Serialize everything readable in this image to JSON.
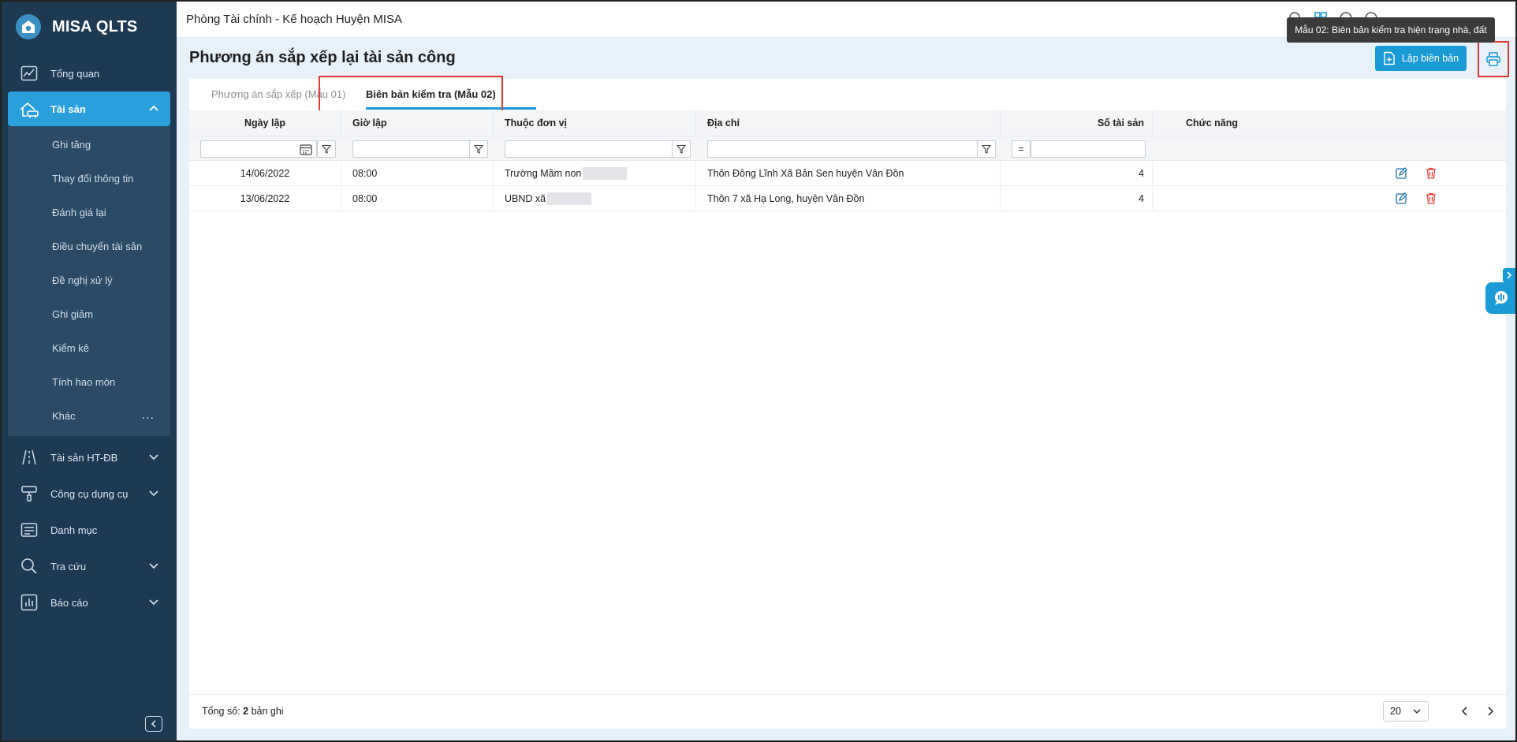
{
  "app": {
    "title": "MISA QLTS"
  },
  "topbar": {
    "org_title": "Phòng Tài chính - Kế hoạch Huyện MISA",
    "tooltip": "Mẫu 02: Biên bản kiểm tra hiện trạng nhà, đất"
  },
  "sidebar": {
    "items": [
      {
        "label": "Tổng quan",
        "icon": "chart-line-icon"
      },
      {
        "label": "Tài sản",
        "icon": "house-car-icon",
        "active": true,
        "expanded": true
      },
      {
        "label": "Tài sản HT-ĐB",
        "icon": "road-icon"
      },
      {
        "label": "Công cụ dụng cụ",
        "icon": "brush-icon"
      },
      {
        "label": "Danh mục",
        "icon": "list-card-icon"
      },
      {
        "label": "Tra cứu",
        "icon": "search-icon"
      },
      {
        "label": "Báo cáo",
        "icon": "report-chart-icon"
      }
    ],
    "submenu": [
      "Ghi tăng",
      "Thay đổi thông tin",
      "Đánh giá lại",
      "Điều chuyển tài sản",
      "Đề nghị xử lý",
      "Ghi giảm",
      "Kiểm kê",
      "Tính hao mòn",
      "Khác"
    ],
    "more_label": "..."
  },
  "page": {
    "title": "Phương án sắp xếp lại tài sản công",
    "create_button": "Lập biên bản",
    "tabs": [
      "Phương án sắp xếp (Mẫu 01)",
      "Biên bản kiểm tra (Mẫu 02)"
    ]
  },
  "table": {
    "columns": [
      "Ngày lập",
      "Giờ lập",
      "Thuộc đơn vị",
      "Địa chỉ",
      "Số tài sản",
      "Chức năng"
    ],
    "filter_operator": "=",
    "rows": [
      {
        "date": "14/06/2022",
        "time": "08:00",
        "unit": "Trường Mầm non",
        "address": "Thôn Đông Lĩnh Xã Bản Sen huyện Vân Đồn",
        "count": "4"
      },
      {
        "date": "13/06/2022",
        "time": "08:00",
        "unit": "UBND xã",
        "address": "Thôn 7 xã Hạ Long, huyện Vân Đồn",
        "count": "4"
      }
    ]
  },
  "footer": {
    "total_prefix": "Tổng số:",
    "total_count": "2",
    "total_suffix": "bản ghi",
    "page_size": "20"
  },
  "colors": {
    "sidebar_bg": "#1e3a52",
    "accent": "#1a9bd6",
    "highlight": "#e53935",
    "delete": "#e53935"
  }
}
